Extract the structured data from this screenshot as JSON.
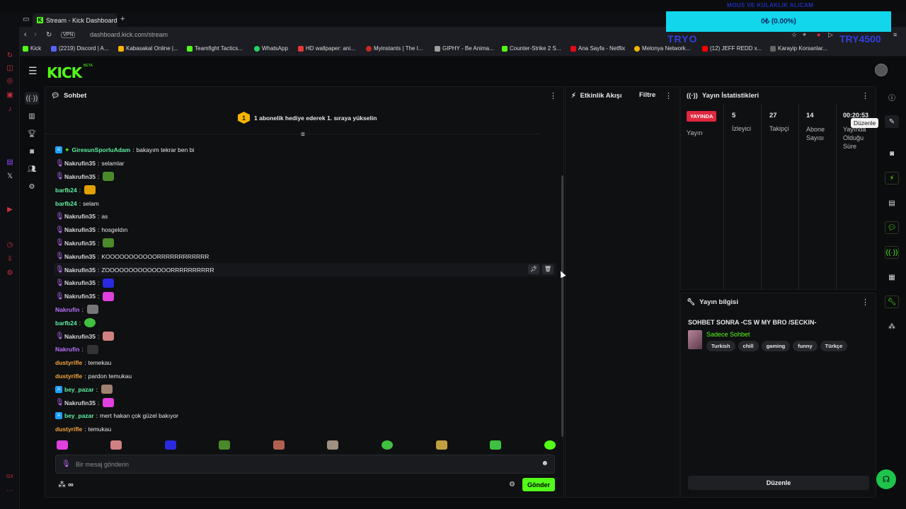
{
  "browser": {
    "tab_title": "Stream - Kick Dashboard",
    "new_tab": "+",
    "url_secure_label": "VPN",
    "url": "dashboard.kick.com/stream",
    "bookmarks": [
      {
        "label": "Kick",
        "color": "#53fc18"
      },
      {
        "label": "(2219) Discord | A...",
        "color": "#5865f2"
      },
      {
        "label": "Kabasakal Online |...",
        "color": "#f4b400"
      },
      {
        "label": "Teamfight Tactics...",
        "color": "#53fc18"
      },
      {
        "label": "WhatsApp",
        "color": "#25d366"
      },
      {
        "label": "HD wallpaper: ani...",
        "color": "#e53935"
      },
      {
        "label": "Myinstants | The I...",
        "color": "#c62828"
      },
      {
        "label": "GIPHY - Be Anima...",
        "color": "#9e9e9e"
      },
      {
        "label": "Counter-Strike 2 S...",
        "color": "#53fc18"
      },
      {
        "label": "Ana Sayfa - Netflix",
        "color": "#e50914"
      },
      {
        "label": "Melonya Network...",
        "color": "#f4b400"
      },
      {
        "label": "(12) JEFF REDD x...",
        "color": "#ff0000"
      },
      {
        "label": "Karayip Korsanlar...",
        "color": "#666666"
      }
    ]
  },
  "overlay": {
    "top_text": "MOUS VE KULAKLIK ALICAM",
    "bar_text": "0₺ (0.00%)",
    "left_text": "TRYO",
    "right_text": "TRY4500"
  },
  "kick": {
    "logo": "KICK",
    "beta": "BETA",
    "chat": {
      "title": "Sohbet",
      "goal_badge": "1",
      "goal_text": "1 abonelik hediye ederek 1. sıraya yükselin",
      "messages": [
        {
          "user": "GiresunSporluAdam",
          "text": "bakayım tekrar ben bi",
          "color": "#5ef0a0",
          "badge": "mod",
          "emote": ""
        },
        {
          "user": "Nakrufin35",
          "text": "selamlar",
          "color": "#d7d7d7",
          "badge": "mic",
          "emote": ""
        },
        {
          "user": "Nakrufin35",
          "text": "",
          "color": "#d7d7d7",
          "badge": "mic",
          "emote": "#4a8a2a"
        },
        {
          "user": "barfb24",
          "text": "",
          "color": "#5ef0a0",
          "badge": "",
          "emote": "#e0a000"
        },
        {
          "user": "barfb24",
          "text": "selam",
          "color": "#5ef0a0",
          "badge": "",
          "emote": ""
        },
        {
          "user": "Nakrufin35",
          "text": "as",
          "color": "#d7d7d7",
          "badge": "mic",
          "emote": ""
        },
        {
          "user": "Nakrufin35",
          "text": "hosgeldın",
          "color": "#d7d7d7",
          "badge": "mic",
          "emote": ""
        },
        {
          "user": "Nakrufin35",
          "text": "",
          "color": "#d7d7d7",
          "badge": "mic",
          "emote": "#4a8a2a"
        },
        {
          "user": "Nakrufin35",
          "text": "KOOOOOOOOOOORRRRRRRRRRRR",
          "color": "#d7d7d7",
          "badge": "mic",
          "emote": ""
        },
        {
          "user": "Nakrufin35",
          "text": "ZOOOOOOOOOOOOOORRRRRRRRRR",
          "color": "#d7d7d7",
          "badge": "mic",
          "emote": "",
          "highlight": true
        },
        {
          "user": "Nakrufin35",
          "text": "",
          "color": "#d7d7d7",
          "badge": "mic",
          "emote": "#2a2ae0"
        },
        {
          "user": "Nakrufin35",
          "text": "",
          "color": "#d7d7d7",
          "badge": "mic",
          "emote": "#e040e0"
        },
        {
          "user": "Nakrufin",
          "text": "",
          "color": "#b872ff",
          "badge": "",
          "emote": "#777777"
        },
        {
          "user": "barfb24",
          "text": "",
          "color": "#5ef0a0",
          "badge": "",
          "emote": "#40c040"
        },
        {
          "user": "Nakrufin35",
          "text": "",
          "color": "#d7d7d7",
          "badge": "mic",
          "emote": "#d08080"
        },
        {
          "user": "Nakrufin",
          "text": "",
          "color": "#b872ff",
          "badge": "",
          "emote": "#333333"
        },
        {
          "user": "dustyrifle",
          "text": "temekau",
          "color": "#f3a53a",
          "badge": "",
          "emote": ""
        },
        {
          "user": "dustyrifle",
          "text": "pardon temukau",
          "color": "#f3a53a",
          "badge": "",
          "emote": ""
        },
        {
          "user": "bey_pazar",
          "text": "",
          "color": "#5ef0a0",
          "badge": "mod",
          "emote": "#a08070"
        },
        {
          "user": "Nakrufin35",
          "text": "",
          "color": "#d7d7d7",
          "badge": "mic",
          "emote": "#e040e0"
        },
        {
          "user": "bey_pazar",
          "text": "mert hakan çok güzel bakıyor",
          "color": "#5ef0a0",
          "badge": "mod",
          "emote": ""
        },
        {
          "user": "dustyrifle",
          "text": "temukau",
          "color": "#f3a53a",
          "badge": "",
          "emote": ""
        }
      ],
      "recent_emotes": [
        "#e040e0",
        "#d08080",
        "#2a2ae0",
        "#4a8a2a",
        "#b06050",
        "#a09080",
        "#40c040",
        "#c0a040",
        "#40c040",
        "#53fc18"
      ],
      "input_placeholder": "Bir mesaj gönderin",
      "send_label": "Gönder",
      "infinity": "∞"
    },
    "activity": {
      "title": "Etkinlik Akışı",
      "filter_label": "Filtre"
    },
    "stats": {
      "title": "Yayın İstatistikleri",
      "live_badge": "YAYINDA",
      "live_label": "Yayın",
      "viewers_value": "5",
      "viewers_label": "İzleyici",
      "followers_value": "27",
      "followers_label": "Takipçi",
      "subs_value": "14",
      "subs_label": "Abone Sayısı",
      "uptime_value": "00:20:53",
      "uptime_label": "Yayında Olduğu Süre",
      "tooltip": "Düzenle"
    },
    "info": {
      "title": "Yayın bilgisi",
      "stream_title": "SOHBET SONRA -CS W MY BRO /SECKIN-",
      "category": "Sadece Sohbet",
      "tags": [
        "Turkish",
        "chill",
        "gaming",
        "funny",
        "Türkçe"
      ],
      "edit_label": "Düzenle"
    }
  }
}
